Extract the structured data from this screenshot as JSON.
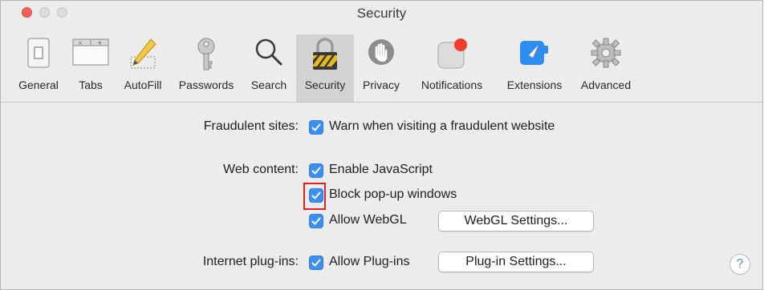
{
  "window": {
    "title": "Security"
  },
  "toolbar": {
    "items": [
      {
        "label": "General",
        "icon": "general-switch-icon"
      },
      {
        "label": "Tabs",
        "icon": "tabs-icon"
      },
      {
        "label": "AutoFill",
        "icon": "pencil-icon"
      },
      {
        "label": "Passwords",
        "icon": "key-icon"
      },
      {
        "label": "Search",
        "icon": "magnifier-icon"
      },
      {
        "label": "Security",
        "icon": "padlock-icon",
        "selected": true
      },
      {
        "label": "Privacy",
        "icon": "hand-icon"
      },
      {
        "label": "Notifications",
        "icon": "notification-badge-icon"
      },
      {
        "label": "Extensions",
        "icon": "compass-icon"
      },
      {
        "label": "Advanced",
        "icon": "gear-icon"
      }
    ]
  },
  "security": {
    "fraudulent_label": "Fraudulent sites:",
    "warn_fraudulent": {
      "label": "Warn when visiting a fraudulent website",
      "checked": true
    },
    "web_content_label": "Web content:",
    "enable_javascript": {
      "label": "Enable JavaScript",
      "checked": true
    },
    "block_popups": {
      "label": "Block pop-up windows",
      "checked": true
    },
    "allow_webgl": {
      "label": "Allow WebGL",
      "checked": true
    },
    "webgl_settings_button": "WebGL Settings...",
    "plugins_label": "Internet plug-ins:",
    "allow_plugins": {
      "label": "Allow Plug-ins",
      "checked": true
    },
    "plugin_settings_button": "Plug-in Settings...",
    "help_button": "?"
  },
  "colors": {
    "checkbox_accent": "#3a8ef6",
    "highlight_box": "#e0231c",
    "close_button": "#fc605c"
  }
}
